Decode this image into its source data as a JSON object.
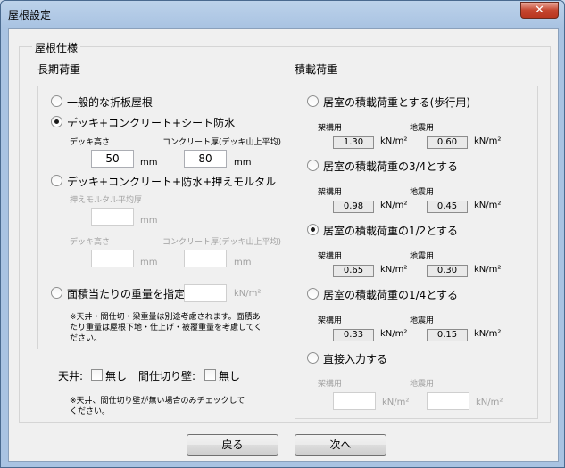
{
  "window": {
    "title": "屋根設定",
    "close_label": "✕"
  },
  "roof_spec": {
    "title": "屋根仕様",
    "long_term": {
      "title": "長期荷重",
      "option1": "一般的な折板屋根",
      "option2": "デッキ+コンクリート+シート防水",
      "deck_height_label": "デッキ高さ",
      "concrete_label": "コンクリート厚(デッキ山上平均)",
      "deck_height_value": "50",
      "concrete_value": "80",
      "unit_mm": "mm",
      "option3": "デッキ+コンクリート+防水+押えモルタル",
      "mortar_label": "押えモルタル平均厚",
      "deck_height_label2": "デッキ高さ",
      "concrete_label2": "コンクリート厚(デッキ山上平均)",
      "option4": "面積当たりの重量を指定",
      "unit_kn": "kN/m²",
      "note": "※天井・間仕切・梁重量は別途考慮されます。面積あたり重量は屋根下地・仕上げ・被覆重量を考慮してください。"
    },
    "ceiling_label": "天井:",
    "ceiling_check": "無し",
    "partition_label": "間仕切り壁:",
    "partition_check": "無し",
    "bottom_note": "※天井、間仕切り壁が無い場合のみチェックしてください。",
    "live_load": {
      "title": "積載荷重",
      "frame_label": "架構用",
      "seismic_label": "地震用",
      "unit": "kN/m²",
      "option1": "居室の積載荷重とする(歩行用)",
      "option1_frame": "1.30",
      "option1_seismic": "0.60",
      "option2": "居室の積載荷重の3/4とする",
      "option2_frame": "0.98",
      "option2_seismic": "0.45",
      "option3": "居室の積載荷重の1/2とする",
      "option3_frame": "0.65",
      "option3_seismic": "0.30",
      "option4": "居室の積載荷重の1/4とする",
      "option4_frame": "0.33",
      "option4_seismic": "0.15",
      "option5": "直接入力する"
    }
  },
  "buttons": {
    "back": "戻る",
    "next": "次へ"
  }
}
